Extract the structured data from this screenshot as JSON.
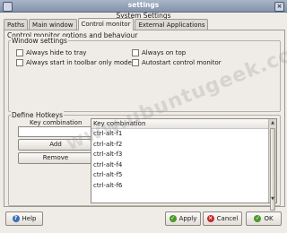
{
  "window": {
    "title": "settings",
    "subtitle": "System Settings"
  },
  "tabs": [
    {
      "label": "Paths"
    },
    {
      "label": "Main window"
    },
    {
      "label": "Control monitor",
      "active": true
    },
    {
      "label": "External Applications"
    }
  ],
  "panel": {
    "heading": "Control monitor options and behaviour",
    "window_settings": {
      "label": "Window settings",
      "options": [
        {
          "label": "Always hide to tray",
          "checked": false
        },
        {
          "label": "Always on top",
          "checked": false
        },
        {
          "label": "Always start in toolbar only mode",
          "checked": false
        },
        {
          "label": "Autostart control monitor",
          "checked": false
        }
      ]
    },
    "hotkeys": {
      "label": "Define Hotkeys",
      "input_label": "Key combination",
      "input_value": "",
      "add_label": "Add",
      "remove_label": "Remove",
      "list_header": "Key combination",
      "items": [
        "ctrl-alt-f1",
        "ctrl-alt-f2",
        "ctrl-alt-f3",
        "ctrl-alt-f4",
        "ctrl-alt-f5",
        "ctrl-alt-f6"
      ]
    }
  },
  "watermark": "www.ubuntugeek.com",
  "buttons": {
    "help": "Help",
    "apply": "Apply",
    "cancel": "Cancel",
    "ok": "OK"
  }
}
